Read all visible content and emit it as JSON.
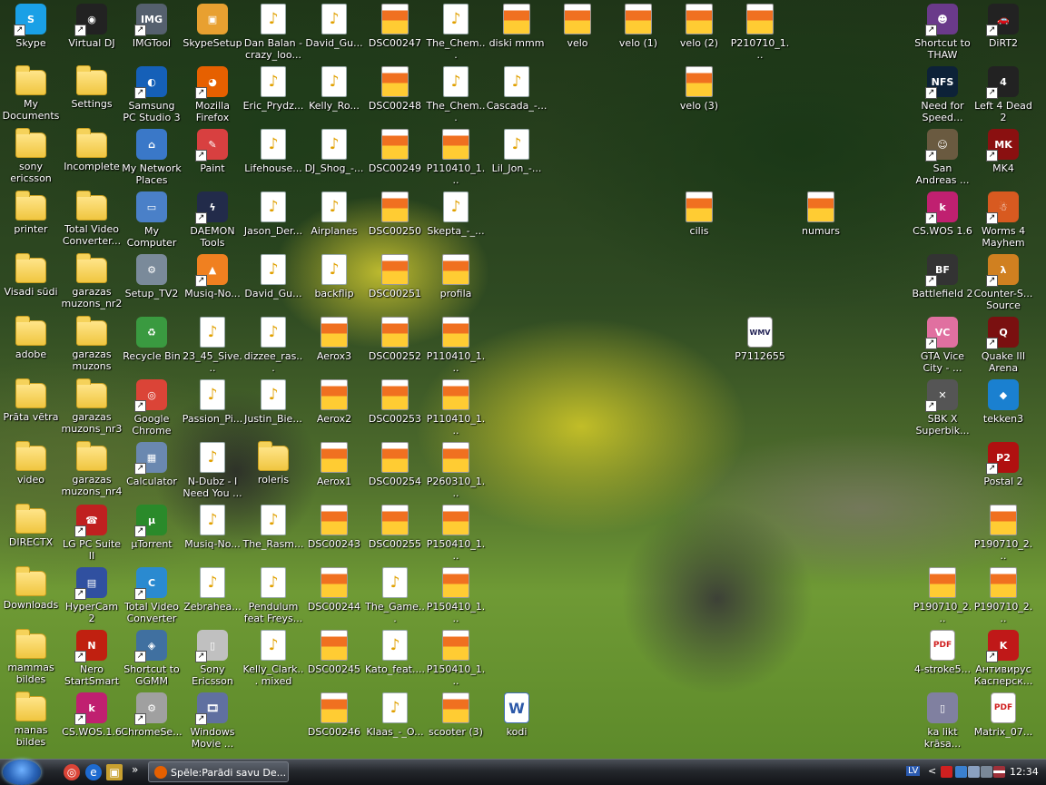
{
  "desktop": {
    "icons": [
      {
        "id": "skype",
        "label": "Skype",
        "type": "app",
        "color": "#1aa0e6",
        "glyph": "S",
        "shortcut": true
      },
      {
        "id": "virtual-dj",
        "label": "Virtual DJ",
        "type": "app",
        "color": "#222222",
        "glyph": "◉",
        "shortcut": true
      },
      {
        "id": "imgtool",
        "label": "IMGTool",
        "type": "app",
        "color": "#55606e",
        "glyph": "IMG",
        "shortcut": true
      },
      {
        "id": "skypesetup",
        "label": "SkypeSetup",
        "type": "app",
        "color": "#e8a030",
        "glyph": "▣",
        "shortcut": false
      },
      {
        "id": "dan-balan",
        "label": "Dan Balan -crazy_loo...",
        "type": "audio"
      },
      {
        "id": "david-gu-1",
        "label": "David_Gu...",
        "type": "audio"
      },
      {
        "id": "dsc00247",
        "label": "DSC00247",
        "type": "image"
      },
      {
        "id": "the-chem-1",
        "label": "The_Chem...",
        "type": "audio"
      },
      {
        "id": "diski-mmm",
        "label": "diski mmm",
        "type": "image"
      },
      {
        "id": "velo",
        "label": "velo",
        "type": "image"
      },
      {
        "id": "velo-1",
        "label": "velo (1)",
        "type": "image"
      },
      {
        "id": "velo-2",
        "label": "velo (2)",
        "type": "image"
      },
      {
        "id": "p210710",
        "label": "P210710_1...",
        "type": "image"
      },
      {
        "id": "shortcut-thaw",
        "label": "Shortcut to THAW",
        "type": "app",
        "color": "#6a3a8a",
        "glyph": "☻",
        "shortcut": true
      },
      {
        "id": "dirt2",
        "label": "DiRT2",
        "type": "app",
        "color": "#222222",
        "glyph": "🚗",
        "shortcut": true
      },
      {
        "id": "my-documents",
        "label": "My Documents",
        "type": "folder"
      },
      {
        "id": "settings",
        "label": "Settings",
        "type": "folder"
      },
      {
        "id": "samsung-pc-studio",
        "label": "Samsung PC Studio 3",
        "type": "app",
        "color": "#1560b8",
        "glyph": "◐",
        "shortcut": true
      },
      {
        "id": "mozilla-firefox",
        "label": "Mozilla Firefox",
        "type": "app",
        "color": "#e66000",
        "glyph": "◕",
        "shortcut": true
      },
      {
        "id": "eric-prydz",
        "label": "Eric_Prydz...",
        "type": "audio"
      },
      {
        "id": "kelly-ro",
        "label": "Kelly_Ro...",
        "type": "audio"
      },
      {
        "id": "dsc00248",
        "label": "DSC00248",
        "type": "image"
      },
      {
        "id": "the-chem-2",
        "label": "The_Chem...",
        "type": "audio"
      },
      {
        "id": "cascada",
        "label": "Cascada_-...",
        "type": "audio"
      },
      {
        "id": "velo-3",
        "label": "velo (3)",
        "type": "image"
      },
      {
        "id": "need-for-speed",
        "label": "Need for Speed...",
        "type": "app",
        "color": "#0d2238",
        "glyph": "NFS",
        "shortcut": true
      },
      {
        "id": "left-4-dead-2",
        "label": "Left 4 Dead 2",
        "type": "app",
        "color": "#222222",
        "glyph": "4",
        "shortcut": true
      },
      {
        "id": "sony-ericsson",
        "label": "sony ericsson",
        "type": "folder"
      },
      {
        "id": "incomplete",
        "label": "Incomplete",
        "type": "folder"
      },
      {
        "id": "my-network-places",
        "label": "My Network Places",
        "type": "app",
        "color": "#3a78c8",
        "glyph": "⌂",
        "shortcut": false
      },
      {
        "id": "paint",
        "label": "Paint",
        "type": "app",
        "color": "#d84040",
        "glyph": "✎",
        "shortcut": true
      },
      {
        "id": "lifehouse",
        "label": "Lifehouse...",
        "type": "audio"
      },
      {
        "id": "dj-shog",
        "label": "DJ_Shog_-...",
        "type": "audio"
      },
      {
        "id": "dsc00249",
        "label": "DSC00249",
        "type": "image"
      },
      {
        "id": "p110410-a",
        "label": "P110410_1...",
        "type": "image"
      },
      {
        "id": "lil-jon",
        "label": "Lil_Jon_-...",
        "type": "audio"
      },
      {
        "id": "san-andreas",
        "label": "San Andreas ...",
        "type": "app",
        "color": "#6a5a40",
        "glyph": "☺",
        "shortcut": true
      },
      {
        "id": "mk4",
        "label": "MK4",
        "type": "app",
        "color": "#8a1010",
        "glyph": "MK",
        "shortcut": true
      },
      {
        "id": "printer",
        "label": "printer",
        "type": "folder"
      },
      {
        "id": "total-video-converter-folder",
        "label": "Total Video Converter...",
        "type": "folder"
      },
      {
        "id": "my-computer",
        "label": "My Computer",
        "type": "app",
        "color": "#4a80c8",
        "glyph": "▭",
        "shortcut": false
      },
      {
        "id": "daemon-tools",
        "label": "DAEMON Tools",
        "type": "app",
        "color": "#222b4a",
        "glyph": "ϟ",
        "shortcut": true
      },
      {
        "id": "jason-der",
        "label": "Jason_Der...",
        "type": "audio"
      },
      {
        "id": "airplanes",
        "label": "Airplanes",
        "type": "audio"
      },
      {
        "id": "dsc00250",
        "label": "DSC00250",
        "type": "image"
      },
      {
        "id": "skepta",
        "label": "Skepta_-_...",
        "type": "audio"
      },
      {
        "id": "cilis",
        "label": "cilis",
        "type": "image"
      },
      {
        "id": "numurs",
        "label": "numurs",
        "type": "image"
      },
      {
        "id": "cs-wos-16",
        "label": "CS.WOS 1.6",
        "type": "app",
        "color": "#c02070",
        "glyph": "k",
        "shortcut": true
      },
      {
        "id": "worms-4",
        "label": "Worms 4 Mayhem",
        "type": "app",
        "color": "#d85a20",
        "glyph": "☃",
        "shortcut": true
      },
      {
        "id": "visadi-sudi",
        "label": "Visadi sūdi",
        "type": "folder"
      },
      {
        "id": "garazas-nr2",
        "label": "garazas muzons_nr2",
        "type": "folder"
      },
      {
        "id": "setup-tv2",
        "label": "Setup_TV2",
        "type": "app",
        "color": "#7a8a9a",
        "glyph": "⚙",
        "shortcut": false
      },
      {
        "id": "musiq-no-1",
        "label": "Musiq-No...",
        "type": "app",
        "color": "#f08020",
        "glyph": "▲",
        "shortcut": true
      },
      {
        "id": "david-gu-2",
        "label": "David_Gu...",
        "type": "audio"
      },
      {
        "id": "backflip",
        "label": "backflip",
        "type": "audio"
      },
      {
        "id": "dsc00251",
        "label": "DSC00251",
        "type": "image"
      },
      {
        "id": "profila",
        "label": "profila",
        "type": "image"
      },
      {
        "id": "battlefield-2",
        "label": "Battlefield 2",
        "type": "app",
        "color": "#333333",
        "glyph": "BF",
        "shortcut": true
      },
      {
        "id": "counter-strike-source",
        "label": "Counter-S... Source",
        "type": "app",
        "color": "#d08020",
        "glyph": "λ",
        "shortcut": true
      },
      {
        "id": "adobe",
        "label": "adobe",
        "type": "folder"
      },
      {
        "id": "garazas-muzons",
        "label": "garazas muzons",
        "type": "folder"
      },
      {
        "id": "recycle-bin",
        "label": "Recycle Bin",
        "type": "app",
        "color": "#3a9a40",
        "glyph": "♻",
        "shortcut": false
      },
      {
        "id": "23-45-sive",
        "label": "23_45_Sive...",
        "type": "audio"
      },
      {
        "id": "dizzee-ras",
        "label": "dizzee_ras...",
        "type": "audio"
      },
      {
        "id": "aerox3",
        "label": "Aerox3",
        "type": "image"
      },
      {
        "id": "dsc00252",
        "label": "DSC00252",
        "type": "image"
      },
      {
        "id": "p110410-b",
        "label": "P110410_1...",
        "type": "image"
      },
      {
        "id": "p7112655",
        "label": "P7112655",
        "type": "wmv",
        "glyph": "WMV"
      },
      {
        "id": "gta-vice-city",
        "label": "GTA Vice City - ...",
        "type": "app",
        "color": "#e070a0",
        "glyph": "VC",
        "shortcut": true
      },
      {
        "id": "quake-3",
        "label": "Quake III Arena",
        "type": "app",
        "color": "#7a1010",
        "glyph": "Q",
        "shortcut": true
      },
      {
        "id": "prata-vetra",
        "label": "Prāta vētra",
        "type": "folder"
      },
      {
        "id": "garazas-nr3",
        "label": "garazas muzons_nr3",
        "type": "folder"
      },
      {
        "id": "google-chrome",
        "label": "Google Chrome",
        "type": "app",
        "color": "#db4437",
        "glyph": "◎",
        "shortcut": true
      },
      {
        "id": "passion-pi",
        "label": "Passion_Pi...",
        "type": "audio"
      },
      {
        "id": "justin-bie",
        "label": "Justin_Bie...",
        "type": "audio"
      },
      {
        "id": "aerox2",
        "label": "Aerox2",
        "type": "image"
      },
      {
        "id": "dsc00253",
        "label": "DSC00253",
        "type": "image"
      },
      {
        "id": "p110410-c",
        "label": "P110410_1...",
        "type": "image"
      },
      {
        "id": "sbk-x",
        "label": "SBK X Superbik...",
        "type": "app",
        "color": "#555555",
        "glyph": "✕",
        "shortcut": true
      },
      {
        "id": "tekken3",
        "label": "tekken3",
        "type": "app",
        "color": "#1a80d0",
        "glyph": "◆",
        "shortcut": false
      },
      {
        "id": "video",
        "label": "video",
        "type": "folder"
      },
      {
        "id": "garazas-nr4",
        "label": "garazas muzons_nr4",
        "type": "folder"
      },
      {
        "id": "calculator",
        "label": "Calculator",
        "type": "app",
        "color": "#6a88b0",
        "glyph": "▦",
        "shortcut": true
      },
      {
        "id": "n-dubz",
        "label": "N-Dubz - I Need You ...",
        "type": "audio"
      },
      {
        "id": "roleris",
        "label": "roleris",
        "type": "folder"
      },
      {
        "id": "aerox1",
        "label": "Aerox1",
        "type": "image"
      },
      {
        "id": "dsc00254",
        "label": "DSC00254",
        "type": "image"
      },
      {
        "id": "p260310",
        "label": "P260310_1...",
        "type": "image"
      },
      {
        "id": "postal-2",
        "label": "Postal 2",
        "type": "app",
        "color": "#b01010",
        "glyph": "P2",
        "shortcut": true
      },
      {
        "id": "directx",
        "label": "DIRECTX",
        "type": "folder"
      },
      {
        "id": "lg-pc-suite",
        "label": "LG PC Suite II",
        "type": "app",
        "color": "#c02020",
        "glyph": "☎",
        "shortcut": true
      },
      {
        "id": "utorrent",
        "label": "µTorrent",
        "type": "app",
        "color": "#2a8a2a",
        "glyph": "µ",
        "shortcut": true
      },
      {
        "id": "musiq-no-2",
        "label": "Musiq-No...",
        "type": "audio"
      },
      {
        "id": "the-rasm",
        "label": "The_Rasm...",
        "type": "audio"
      },
      {
        "id": "dsc00243",
        "label": "DSC00243",
        "type": "image"
      },
      {
        "id": "dsc00255",
        "label": "DSC00255",
        "type": "image"
      },
      {
        "id": "p150410-a",
        "label": "P150410_1...",
        "type": "image"
      },
      {
        "id": "p190710-a",
        "label": "P190710_2...",
        "type": "image"
      },
      {
        "id": "downloads",
        "label": "Downloads",
        "type": "folder"
      },
      {
        "id": "hypercam-2",
        "label": "HyperCam 2",
        "type": "app",
        "color": "#3050a0",
        "glyph": "▤",
        "shortcut": true
      },
      {
        "id": "total-video-converter",
        "label": "Total Video Converter",
        "type": "app",
        "color": "#2a8ad0",
        "glyph": "C",
        "shortcut": true
      },
      {
        "id": "zebrahea",
        "label": "Zebrahea...",
        "type": "audio"
      },
      {
        "id": "pendulum",
        "label": "Pendulum feat Freys...",
        "type": "audio"
      },
      {
        "id": "dsc00244",
        "label": "DSC00244",
        "type": "image"
      },
      {
        "id": "the-game",
        "label": "The_Game...",
        "type": "audio"
      },
      {
        "id": "p150410-b",
        "label": "P150410_1...",
        "type": "image"
      },
      {
        "id": "p190710-b",
        "label": "P190710_2...",
        "type": "image"
      },
      {
        "id": "p190710-c",
        "label": "P190710_2...",
        "type": "image"
      },
      {
        "id": "mammas-bildes",
        "label": "mammas bildes",
        "type": "folder"
      },
      {
        "id": "nero-startsmart",
        "label": "Nero StartSmart",
        "type": "app",
        "color": "#c02010",
        "glyph": "N",
        "shortcut": true
      },
      {
        "id": "shortcut-ggmm",
        "label": "Shortcut to GGMM",
        "type": "app",
        "color": "#4070a0",
        "glyph": "◈",
        "shortcut": true
      },
      {
        "id": "sony-ericsson-fi",
        "label": "Sony Ericsson Fi...",
        "type": "app",
        "color": "#c0c0c0",
        "glyph": "▯",
        "shortcut": true
      },
      {
        "id": "kelly-clark",
        "label": "Kelly_Clark... mixed",
        "type": "audio"
      },
      {
        "id": "dsc00245",
        "label": "DSC00245",
        "type": "image"
      },
      {
        "id": "kato-feat",
        "label": "Kato_feat....",
        "type": "audio"
      },
      {
        "id": "p150410-c",
        "label": "P150410_1...",
        "type": "image"
      },
      {
        "id": "4-stroke",
        "label": "4-stroke5...",
        "type": "pdf",
        "glyph": "PDF"
      },
      {
        "id": "antivirus",
        "label": "Антивирус Касперск...",
        "type": "app",
        "color": "#c01818",
        "glyph": "K",
        "shortcut": true
      },
      {
        "id": "manas-bildes",
        "label": "manas bildes",
        "type": "folder"
      },
      {
        "id": "cs-wos-16-b",
        "label": "CS.WOS.1.6",
        "type": "app",
        "color": "#c02070",
        "glyph": "k",
        "shortcut": true
      },
      {
        "id": "chromese",
        "label": "ChromeSe...",
        "type": "app",
        "color": "#a0a0a0",
        "glyph": "⚙",
        "shortcut": true
      },
      {
        "id": "windows-movie",
        "label": "Windows Movie ...",
        "type": "app",
        "color": "#6070a0",
        "glyph": "🎞",
        "shortcut": true
      },
      {
        "id": "dsc00246",
        "label": "DSC00246",
        "type": "image"
      },
      {
        "id": "klaas-o",
        "label": "Klaas_-_O...",
        "type": "audio"
      },
      {
        "id": "scooter-3",
        "label": "scooter (3)",
        "type": "image"
      },
      {
        "id": "kodi",
        "label": "kodi",
        "type": "word",
        "glyph": "W"
      },
      {
        "id": "ka-likt-krasa",
        "label": "ka likt krāsa...",
        "type": "app",
        "color": "#8080a0",
        "glyph": "▯",
        "shortcut": false
      },
      {
        "id": "matrix-07",
        "label": "Matrix_07...",
        "type": "pdf",
        "glyph": "PDF"
      }
    ]
  },
  "taskbar": {
    "start_label": "Start",
    "quicklaunch": [
      {
        "id": "chrome",
        "glyph": "◎",
        "color": "#db4437"
      },
      {
        "id": "ie",
        "glyph": "e",
        "color": "#1e6ad0"
      },
      {
        "id": "show-desktop",
        "glyph": "▣",
        "color": "#c8a030"
      }
    ],
    "overflow": "»",
    "task": {
      "label": "Spēle:Parādi savu De...",
      "icon_color": "#e66000"
    },
    "tray": {
      "language": "LV",
      "chevron": "<",
      "clock": "12:34"
    }
  }
}
